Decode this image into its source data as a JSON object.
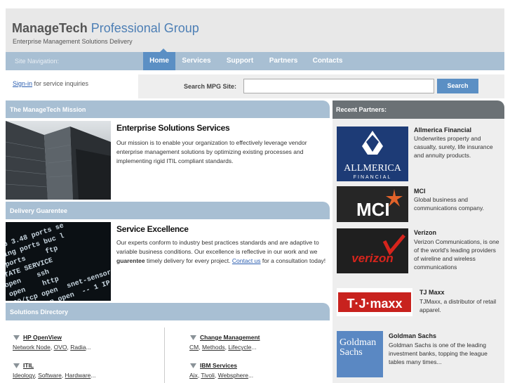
{
  "header": {
    "brand_bold": "ManageTech",
    "brand_light": "Professional Group",
    "tagline": "Enterprise Management Solutions Delivery"
  },
  "nav": {
    "label": "Site Navigation:",
    "items": [
      "Home",
      "Services",
      "Support",
      "Partners",
      "Contacts"
    ],
    "active": "Home"
  },
  "signin": {
    "link": "Sign-in",
    "text": "for service inquiries"
  },
  "search": {
    "label": "Search MPG Site:",
    "placeholder": "",
    "button": "Search"
  },
  "sections": {
    "mission_bar": "The ManageTech Mission",
    "delivery_bar": "Delivery Guarentee",
    "directory_bar": "Solutions Directory",
    "partners_bar": "Recent Partners:"
  },
  "mission": {
    "title": "Enterprise Solutions Services",
    "text": "Our mission is to enable your organization to effectively leverage vendor enterprise management solutions by optimizing existing processes and implementing rigid ITIL compliant standards."
  },
  "delivery": {
    "title": "Service Excellence",
    "text_1": "Our experts conform to industry best practices standards and are adaptive to variable business conditions. Our excellence is reflective in our work and we",
    "text_bold": "guarentee",
    "text_2": "timely delivery for every project.",
    "link": "Contact us",
    "text_3": "for a consultation today!"
  },
  "directory": [
    {
      "title": "HP OpenView",
      "links": [
        "Network Node",
        "OVO",
        "Radia"
      ]
    },
    {
      "title": "Change Management",
      "links": [
        "CM",
        "Methods",
        "Lifecycle"
      ]
    },
    {
      "title": "ITIL",
      "links": [
        "Ideology",
        "Software",
        "Hardware"
      ]
    },
    {
      "title": "IBM Services",
      "links": [
        "Aix",
        "Tivoli",
        "Websphere"
      ]
    }
  ],
  "partners": [
    {
      "name": "Allmerica Financial",
      "logo": "ALLMERICA",
      "logo_sub": "FINANCIAL",
      "desc": "Underwrites property and casualty, surety, life insurance and annuity products."
    },
    {
      "name": "MCI",
      "logo": "MCI",
      "desc": "Global business and communications company."
    },
    {
      "name": "Verizon",
      "logo": "verizon",
      "desc": "Verizon Communications, is one of the world's leading providers of wireline and wireless communications"
    },
    {
      "name": "TJ Maxx",
      "logo": "T·J·maxx",
      "desc": "TJMaxx, a distributor of retail apparel."
    },
    {
      "name": "Goldman Sachs",
      "logo": "Goldman Sachs",
      "desc": "Goldman Sachs is one of the leading investment banks, topping the league tables many times..."
    }
  ],
  "colors": {
    "nav_bg": "#a8bfd3",
    "accent": "#5b8fc4",
    "partners_bar": "#6b7175",
    "brand_blue": "#4d7fb5"
  },
  "icons": [
    "arrow-icon",
    "mci-star-icon",
    "verizon-check-icon",
    "allmerica-eagle-icon"
  ]
}
